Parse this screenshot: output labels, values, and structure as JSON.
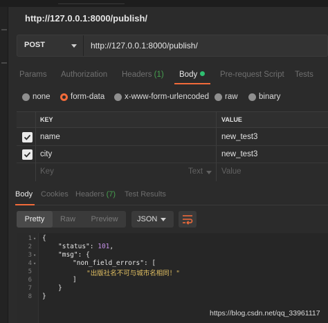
{
  "request": {
    "title": "http://127.0.0.1:8000/publish/",
    "method": "POST",
    "url": "http://127.0.0.1:8000/publish/"
  },
  "request_tabs": [
    {
      "label": "Params"
    },
    {
      "label": "Authorization"
    },
    {
      "label": "Headers",
      "count": "(1)"
    },
    {
      "label": "Body"
    },
    {
      "label": "Pre-request Script"
    },
    {
      "label": "Tests"
    }
  ],
  "body_types": [
    {
      "label": "none",
      "selected": false
    },
    {
      "label": "form-data",
      "selected": true
    },
    {
      "label": "x-www-form-urlencoded",
      "selected": false
    },
    {
      "label": "raw",
      "selected": false
    },
    {
      "label": "binary",
      "selected": false
    }
  ],
  "form_table": {
    "headers": [
      "KEY",
      "VALUE"
    ],
    "rows": [
      {
        "checked": true,
        "key": "name",
        "value": "new_test3"
      },
      {
        "checked": true,
        "key": "city",
        "value": "new_test3"
      }
    ],
    "placeholder": {
      "key": "Key",
      "type": "Text",
      "value": "Value"
    }
  },
  "response_tabs": [
    {
      "label": "Body"
    },
    {
      "label": "Cookies"
    },
    {
      "label": "Headers",
      "count": "(7)"
    },
    {
      "label": "Test Results"
    }
  ],
  "response_format": {
    "modes": [
      "Pretty",
      "Raw",
      "Preview"
    ],
    "active_mode": "Pretty",
    "language": "JSON"
  },
  "response_body": {
    "line_numbers": [
      "1",
      "2",
      "3",
      "4",
      "5",
      "6",
      "7",
      "8"
    ],
    "lines": {
      "l1": "{",
      "l2_key": "\"status\"",
      "l2_sep": ": ",
      "l2_val": "101",
      "l2_end": ",",
      "l3_key": "\"msg\"",
      "l3_sep": ": {",
      "l4_key": "\"non_field_errors\"",
      "l4_sep": ": [",
      "l5_val": "\"出版社名不可与城市名相同！\"",
      "l6": "]",
      "l7": "}",
      "l8": "}"
    }
  },
  "watermark": "https://blog.csdn.net/qq_33961117",
  "colors": {
    "accent": "#f26b3a",
    "status_dot": "#2fbf71",
    "count": "#47a04f",
    "string": "#e2c062",
    "number": "#c792ea"
  },
  "icons": {
    "dropdown": "chevron-down-icon",
    "checkbox": "check-icon",
    "wrap": "wrap-lines-icon"
  }
}
